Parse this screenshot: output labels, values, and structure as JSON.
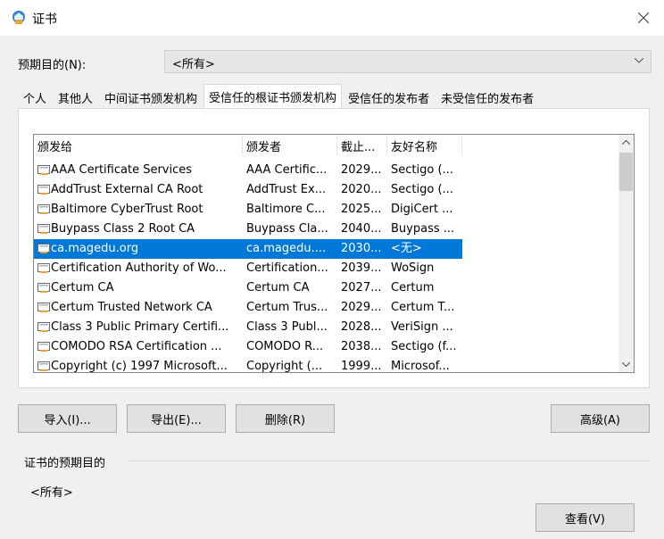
{
  "window": {
    "title": "证书",
    "close_glyph": "✕"
  },
  "purpose": {
    "label": "预期目的(N):",
    "value": "<所有>"
  },
  "tabs": [
    "个人",
    "其他人",
    "中间证书颁发机构",
    "受信任的根证书颁发机构",
    "受信任的发布者",
    "未受信任的发布者"
  ],
  "active_tab": "受信任的根证书颁发机构",
  "list": {
    "columns": [
      "颁发给",
      "颁发者",
      "截止...",
      "友好名称"
    ],
    "rows": [
      [
        "AAA Certificate Services",
        "AAA Certific...",
        "2029...",
        "Sectigo (..."
      ],
      [
        "AddTrust External CA Root",
        "AddTrust Ex...",
        "2020...",
        "Sectigo (..."
      ],
      [
        "Baltimore CyberTrust Root",
        "Baltimore C...",
        "2025...",
        "DigiCert ..."
      ],
      [
        "Buypass Class 2 Root CA",
        "Buypass Cla...",
        "2040...",
        "Buypass ..."
      ],
      [
        "ca.magedu.org",
        "ca.magedu....",
        "2030...",
        "<无>"
      ],
      [
        "Certification Authority of Wo...",
        "Certification...",
        "2039...",
        "WoSign"
      ],
      [
        "Certum CA",
        "Certum CA",
        "2027...",
        "Certum"
      ],
      [
        "Certum Trusted Network CA",
        "Certum Trus...",
        "2029...",
        "Certum T..."
      ],
      [
        "Class 3 Public Primary Certifi...",
        "Class 3 Publ...",
        "2028...",
        "VeriSign ..."
      ],
      [
        "COMODO RSA Certification ...",
        "COMODO R...",
        "2038...",
        "Sectigo (f..."
      ],
      [
        "Copyright (c) 1997 Microsoft...",
        "Copyright (...",
        "1999...",
        "Microsof..."
      ]
    ],
    "selected_row": "ca.magedu.org"
  },
  "buttons": {
    "import": "导入(I)...",
    "export": "导出(E)...",
    "delete": "删除(R)",
    "advanced": "高级(A)",
    "view": "查看(V)"
  },
  "purposes_group": {
    "label": "证书的预期目的",
    "value": "<所有>"
  },
  "colors": {
    "selection": "#0078d7",
    "background": "#f0f0f0"
  }
}
